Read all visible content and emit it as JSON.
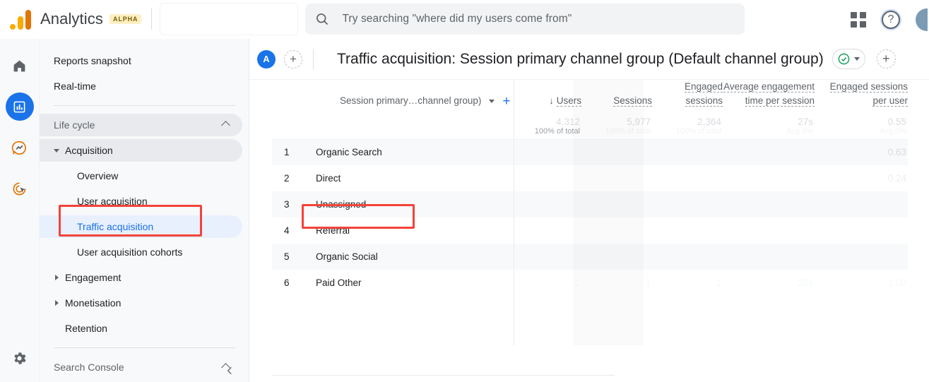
{
  "topbar": {
    "brand": "Analytics",
    "alpha_badge": "ALPHA",
    "search_placeholder": "Try searching \"where did my users come from\"",
    "icons": {
      "search": "search-icon",
      "apps": "apps-grid-icon",
      "help": "?",
      "avatar": "user-avatar"
    }
  },
  "rail": {
    "items": [
      {
        "name": "home-icon",
        "active": false
      },
      {
        "name": "reports-icon",
        "active": true
      },
      {
        "name": "explore-icon",
        "active": false
      },
      {
        "name": "advertising-icon",
        "active": false
      }
    ],
    "settings": "gear-icon"
  },
  "nav": {
    "items": [
      {
        "label": "Reports snapshot",
        "level": "top"
      },
      {
        "label": "Real-time",
        "level": "top"
      },
      {
        "label": "Life cycle",
        "level": "section",
        "collapsed": false
      },
      {
        "label": "Acquisition",
        "level": "group",
        "expanded": true
      },
      {
        "label": "Overview",
        "level": "sub"
      },
      {
        "label": "User acquisition",
        "level": "sub"
      },
      {
        "label": "Traffic acquisition",
        "level": "sub",
        "selected": true
      },
      {
        "label": "User acquisition cohorts",
        "level": "sub"
      },
      {
        "label": "Engagement",
        "level": "group"
      },
      {
        "label": "Monetisation",
        "level": "group"
      },
      {
        "label": "Retention",
        "level": "l1"
      },
      {
        "label": "Search Console",
        "level": "section"
      }
    ]
  },
  "header": {
    "comparison_chip": "A",
    "add_comparison": "+",
    "title": "Traffic acquisition: Session primary channel group (Default channel group)",
    "save_state_icon": "check-circle-icon",
    "add_button": "+"
  },
  "table": {
    "dimension_header": "Session primary…channel group)",
    "metrics": [
      "Users",
      "Sessions",
      "Engaged sessions",
      "Average engagement time per session",
      "Engaged sessions per user"
    ],
    "sort_column": "Users",
    "sort_direction": "descending",
    "totals": {
      "users": "4,312",
      "sessions": "5,977",
      "engaged_sessions": "2,364",
      "avg_engagement_time": "27s",
      "engaged_per_user": "0.55",
      "sub_users": "100% of total",
      "sub_sessions": "100% of total",
      "sub_engaged": "100% of total",
      "sub_time": "Avg 0%",
      "sub_per_user": "Avg 0%"
    },
    "rows": [
      {
        "rank": "1",
        "channel": "Organic Search",
        "users": "",
        "sessions": "",
        "engaged_sessions": "",
        "avg_time": "",
        "per_user": "0.63"
      },
      {
        "rank": "2",
        "channel": "Direct",
        "users": "",
        "sessions": "",
        "engaged_sessions": "",
        "avg_time": "",
        "per_user": "0.24"
      },
      {
        "rank": "3",
        "channel": "Unassigned",
        "users": "",
        "sessions": "",
        "engaged_sessions": "",
        "avg_time": "",
        "per_user": ""
      },
      {
        "rank": "4",
        "channel": "Referral",
        "users": "",
        "sessions": "",
        "engaged_sessions": "",
        "avg_time": "",
        "per_user": ""
      },
      {
        "rank": "5",
        "channel": "Organic Social",
        "users": "",
        "sessions": "",
        "engaged_sessions": "",
        "avg_time": "",
        "per_user": ""
      },
      {
        "rank": "6",
        "channel": "Paid Other",
        "users": "1",
        "sessions": "1",
        "engaged_sessions": "1",
        "avg_time": "20s",
        "per_user": "1.00"
      }
    ]
  },
  "annotations": {
    "nav_highlight": "Traffic acquisition",
    "cell_highlight": "Organic Search",
    "color": "#f4433a"
  },
  "colors": {
    "accent_blue": "#1a73e8",
    "brand_orange": "#e37400",
    "selected_bg": "#e8f0fe",
    "panel_bg": "#f8f9fa"
  }
}
